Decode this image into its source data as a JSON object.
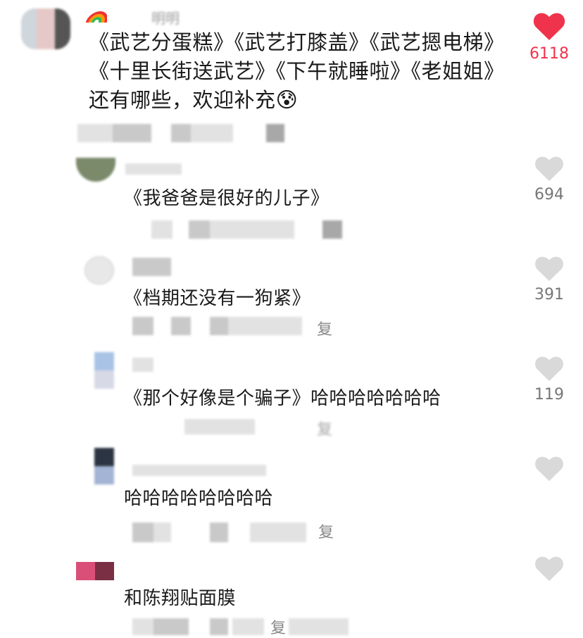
{
  "comments": [
    {
      "username": "明明",
      "text": "《武艺分蛋糕》《武艺打膝盖》《武艺摁电梯》《十里长街送武艺》《下午就睡啦》《老姐姐》还有哪些，欢迎补充",
      "emoji": "😰",
      "likes": "6118",
      "liked": true,
      "like_color": "#f0334c"
    },
    {
      "text": "《我爸爸是很好的儿子》",
      "likes": "694"
    },
    {
      "text": "《档期还没有一狗紧》",
      "likes": "391",
      "meta": "复"
    },
    {
      "text": "《那个好像是个骗子》哈哈哈哈哈哈哈",
      "likes": "119",
      "meta": "复"
    },
    {
      "text": "哈哈哈哈哈哈哈哈",
      "likes": "",
      "meta": "复"
    },
    {
      "text": "和陈翔贴面膜",
      "likes": "",
      "meta": "复"
    }
  ],
  "icons": {
    "heart": "heart-icon"
  },
  "colors": {
    "liked_heart": "#f0334c",
    "unliked_heart": "#d9d9d9"
  }
}
